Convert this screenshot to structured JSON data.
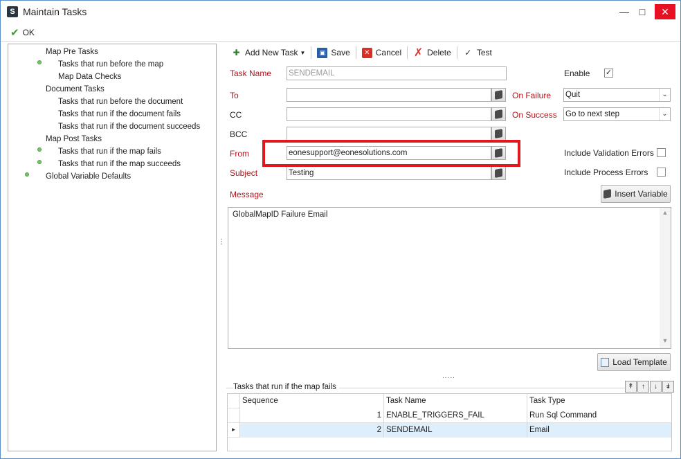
{
  "window": {
    "title": "Maintain Tasks",
    "app_icon": "app-logo-icon"
  },
  "ok_bar": {
    "ok_label": "OK"
  },
  "tree": {
    "items": [
      {
        "label": "Map Pre Tasks",
        "has_dot": false
      },
      {
        "label": "Tasks that run before the map",
        "has_dot": true
      },
      {
        "label": "Map Data Checks",
        "has_dot": false
      },
      {
        "label": "Document Tasks",
        "has_dot": false
      },
      {
        "label": "Tasks that run before the document",
        "has_dot": false
      },
      {
        "label": "Tasks that run if the document fails",
        "has_dot": false
      },
      {
        "label": "Tasks that run if the document succeeds",
        "has_dot": false
      },
      {
        "label": "Map Post Tasks",
        "has_dot": false
      },
      {
        "label": "Tasks that run if the map fails",
        "has_dot": true
      },
      {
        "label": "Tasks that run if the map succeeds",
        "has_dot": true
      },
      {
        "label": "Global Variable Defaults",
        "has_dot": true
      }
    ]
  },
  "toolbar": {
    "add_new_task": "Add New Task",
    "save": "Save",
    "cancel": "Cancel",
    "delete": "Delete",
    "test": "Test"
  },
  "form": {
    "task_name_label": "Task Name",
    "task_name_value": "SENDEMAIL",
    "enable_label": "Enable",
    "enable_checked": true,
    "to_label": "To",
    "to_value": "",
    "cc_label": "CC",
    "cc_value": "",
    "bcc_label": "BCC",
    "bcc_value": "",
    "from_label": "From",
    "from_value": "eonesupport@eonesolutions.com",
    "subject_label": "Subject",
    "subject_value": "Testing",
    "message_label": "Message",
    "message_value": "GlobalMapID Failure Email",
    "on_failure_label": "On Failure",
    "on_failure_value": "Quit",
    "on_success_label": "On Success",
    "on_success_value": "Go to next step",
    "include_validation_errors_label": "Include Validation Errors",
    "include_validation_errors_checked": false,
    "include_process_errors_label": "Include Process Errors",
    "include_process_errors_checked": false,
    "insert_variable_label": "Insert Variable",
    "load_template_label": "Load Template"
  },
  "tasks_grid": {
    "group_title": "Tasks that run if the map fails",
    "columns": [
      "Sequence",
      "Task Name",
      "Task Type"
    ],
    "rows": [
      {
        "sequence": "1",
        "task_name": "ENABLE_TRIGGERS_FAIL",
        "task_type": "Run Sql Command",
        "selected": false
      },
      {
        "sequence": "2",
        "task_name": "SENDEMAIL",
        "task_type": "Email",
        "selected": true
      }
    ],
    "nav_icons": [
      "move-top-icon",
      "move-up-icon",
      "move-down-icon",
      "move-bottom-icon"
    ]
  },
  "colors": {
    "required_label": "#b0141a",
    "highlight": "#e0181e",
    "selected_row": "#dfeefb",
    "tree_dot": "#79c36d"
  }
}
